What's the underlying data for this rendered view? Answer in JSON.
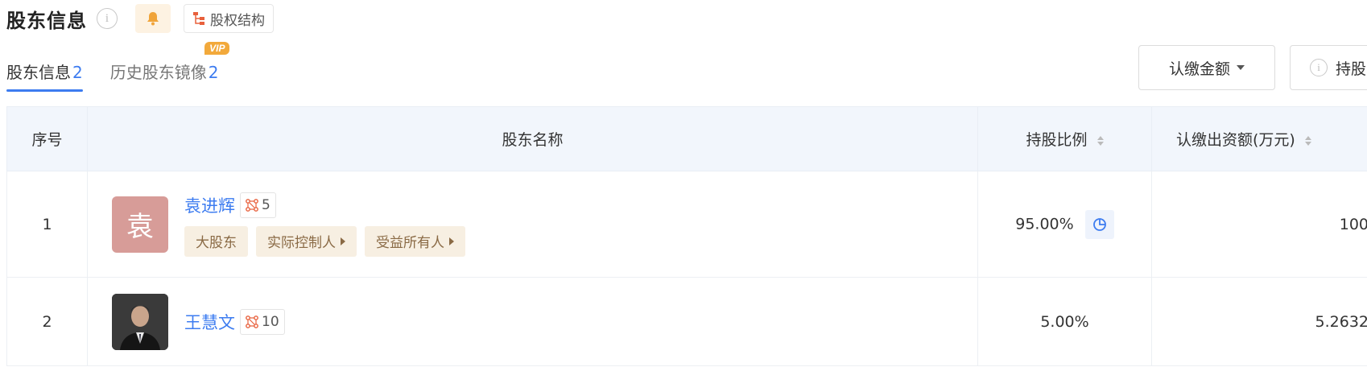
{
  "header": {
    "title": "股东信息",
    "info_glyph": "i",
    "bell_icon": "bell-icon",
    "structure_button_label": "股权结构"
  },
  "tabs": [
    {
      "label": "股东信息",
      "count": "2",
      "active": true
    },
    {
      "label": "历史股东镜像",
      "count": "2",
      "badge": "VIP",
      "active": false
    }
  ],
  "toolbar": {
    "amount_label": "认缴金额",
    "holding_label": "持股"
  },
  "table": {
    "headers": {
      "index": "序号",
      "name": "股东名称",
      "ratio": "持股比例",
      "amount": "认缴出资额(万元)"
    },
    "rows": [
      {
        "index": "1",
        "avatar_char": "袁",
        "name": "袁进辉",
        "relation_count": "5",
        "tags": [
          "大股东",
          "实际控制人",
          "受益所有人"
        ],
        "ratio": "95.00%",
        "amount": "100"
      },
      {
        "index": "2",
        "avatar_char": "",
        "name": "王慧文",
        "relation_count": "10",
        "tags": [],
        "ratio": "5.00%",
        "amount": "5.2632"
      }
    ]
  },
  "colors": {
    "accent": "#3d7cf0",
    "tag_bg": "#f7efe2",
    "vip": "#f2a93b",
    "avatar_bg": "#d79c98"
  }
}
